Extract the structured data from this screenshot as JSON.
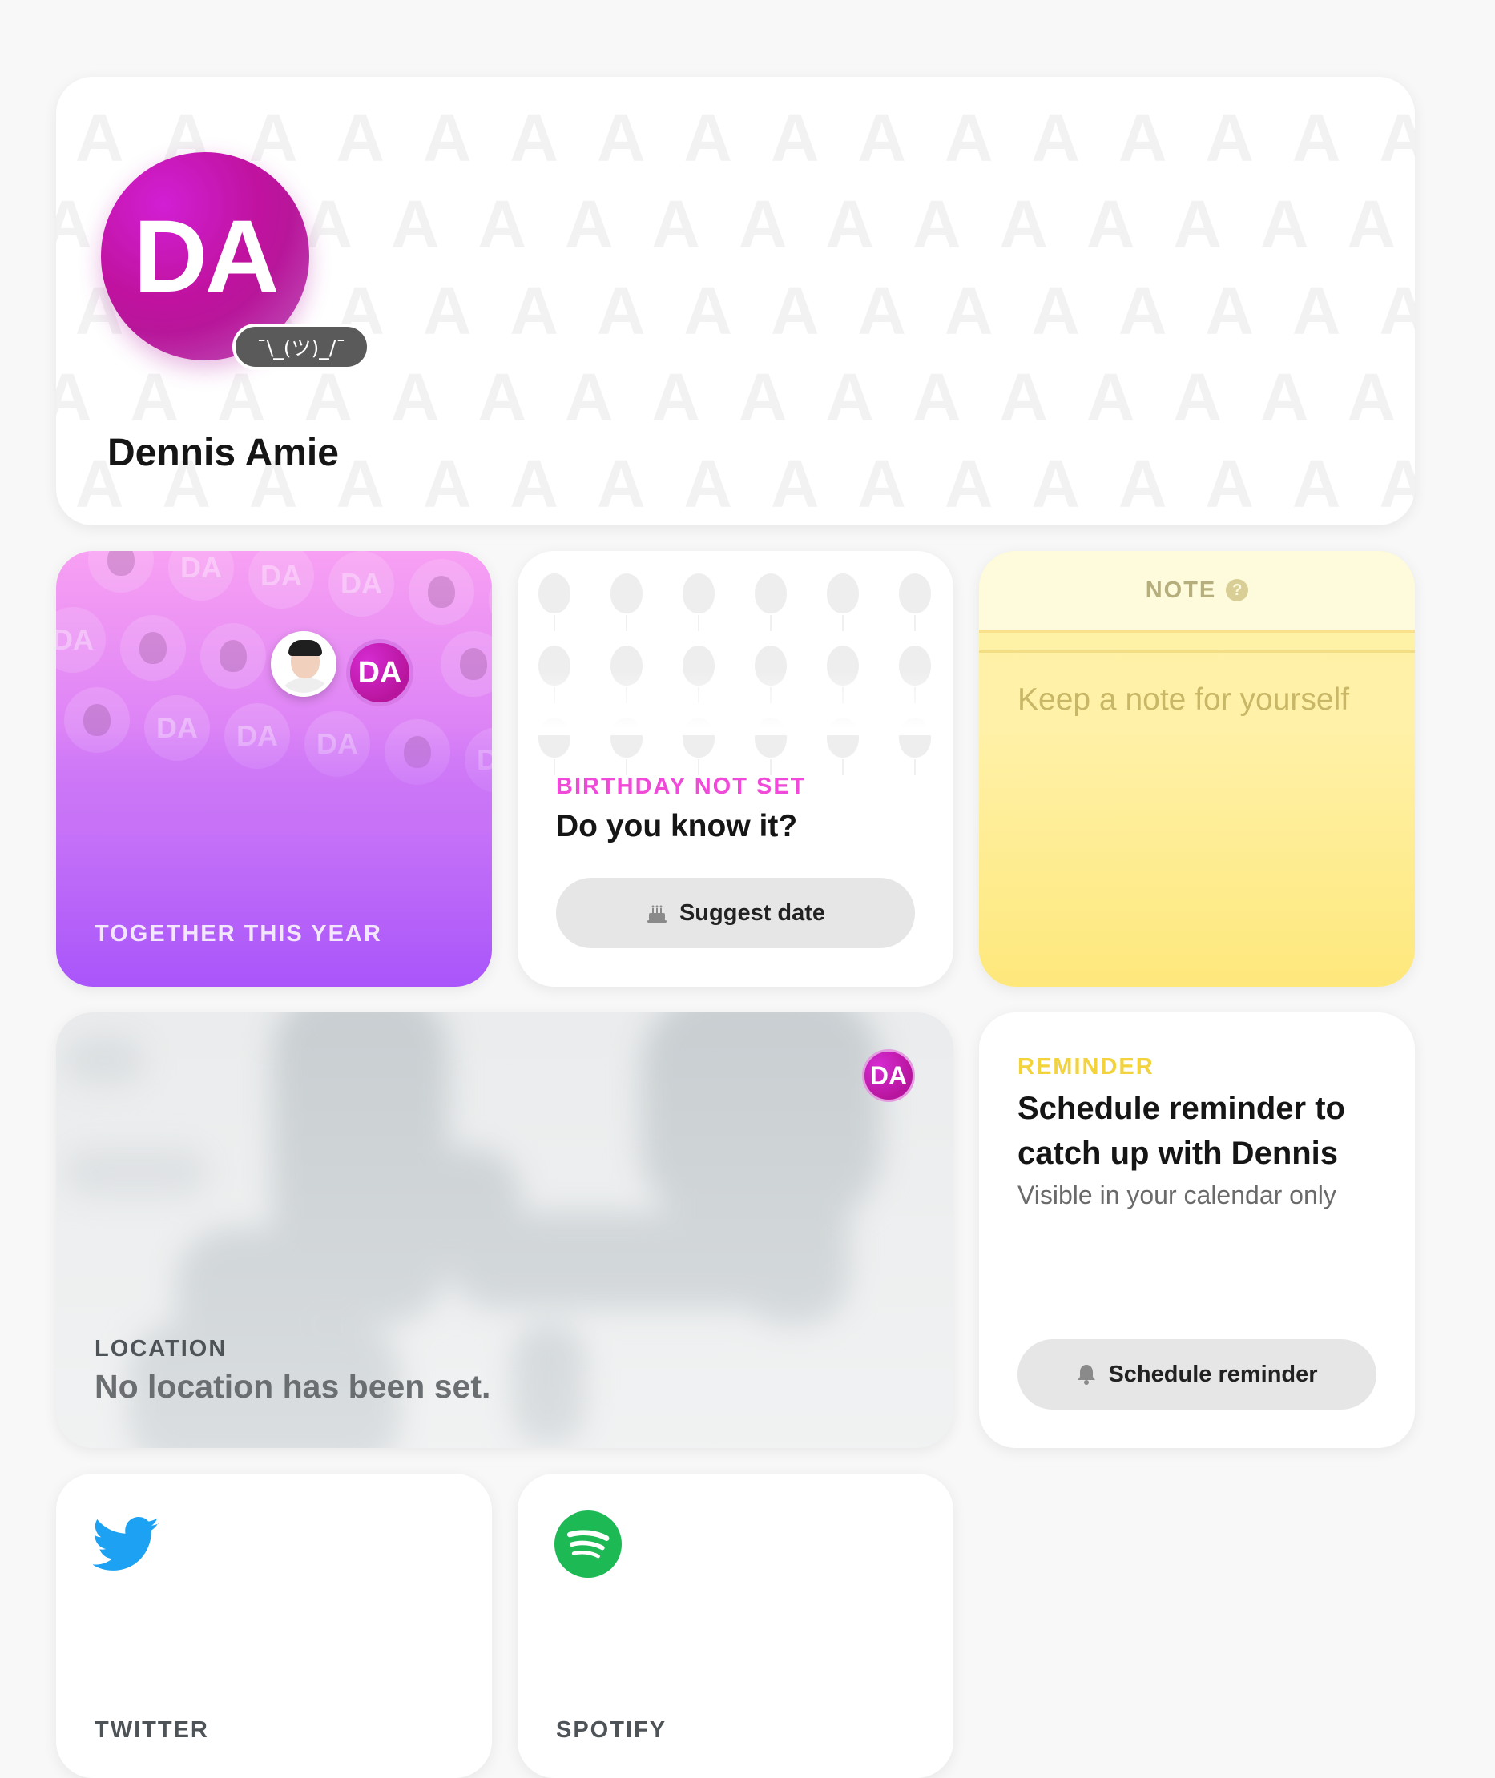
{
  "profile": {
    "initials": "DA",
    "status_emoji": "¯\\_(ツ)_/¯",
    "name": "Dennis Amie",
    "pattern_letter": "A",
    "avatar_gradient": [
      "#d21fd4",
      "#b8169a"
    ]
  },
  "together": {
    "label": "TOGETHER THIS YEAR",
    "avatar_initials": "DA",
    "bubble_text": "DA",
    "gradient": [
      "#f8a0f3",
      "#a955fa"
    ]
  },
  "birthday": {
    "label": "BIRTHDAY NOT SET",
    "question": "Do you know it?",
    "button_label": "Suggest date",
    "button_icon": "cake-icon",
    "accent": "#ef4bd8"
  },
  "note": {
    "label": "NOTE",
    "help_icon": "question-circle-icon",
    "help_glyph": "?",
    "placeholder": "Keep a note for yourself",
    "color": "#fee87c"
  },
  "location": {
    "label": "LOCATION",
    "value": "No location has been set.",
    "avatar_initials": "DA"
  },
  "reminder": {
    "label": "REMINDER",
    "title": "Schedule reminder to catch up with Dennis",
    "subtitle": "Visible in your calendar only",
    "button_label": "Schedule reminder",
    "button_icon": "bell-icon",
    "accent": "#f2d33e"
  },
  "socials": [
    {
      "label": "TWITTER",
      "icon": "twitter-icon",
      "color": "#1da1f2"
    },
    {
      "label": "SPOTIFY",
      "icon": "spotify-icon",
      "color": "#1db954"
    }
  ]
}
